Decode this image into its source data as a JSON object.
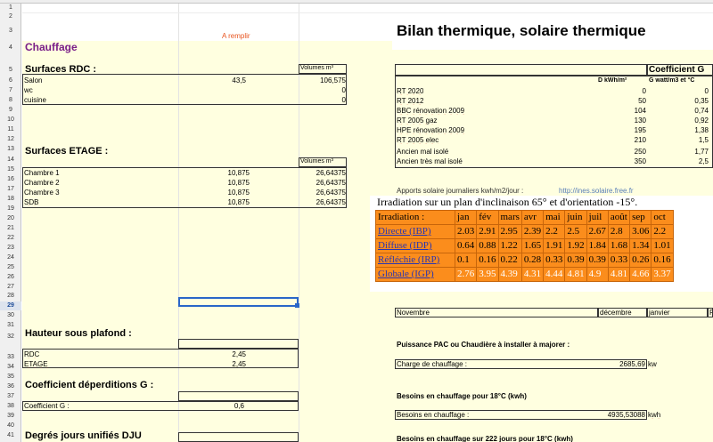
{
  "row_numbers": [
    "1",
    "2",
    "3",
    "4",
    "5",
    "6",
    "7",
    "8",
    "9",
    "10",
    "11",
    "12",
    "13",
    "14",
    "15",
    "16",
    "17",
    "18",
    "19",
    "20",
    "21",
    "22",
    "23",
    "24",
    "25",
    "26",
    "27",
    "28",
    "29",
    "30",
    "31",
    "32",
    "33",
    "34",
    "35",
    "36",
    "37",
    "38",
    "39",
    "40",
    "41"
  ],
  "active_row": "29",
  "left": {
    "a_remplir": "A remplir",
    "chauffage": "Chauffage",
    "rdc": {
      "title": "Surfaces RDC :",
      "vol_header": "Volumes m³",
      "rows": [
        {
          "name": "Salon",
          "surface": "43,5",
          "volume": "106,575"
        },
        {
          "name": "wc",
          "surface": "",
          "volume": "0"
        },
        {
          "name": "cuisine",
          "surface": "",
          "volume": "0"
        }
      ]
    },
    "etage": {
      "title": "Surfaces ETAGE :",
      "vol_header": "Volumes m³",
      "rows": [
        {
          "name": "Chambre 1",
          "surface": "10,875",
          "volume": "26,64375"
        },
        {
          "name": "Chambre 2",
          "surface": "10,875",
          "volume": "26,64375"
        },
        {
          "name": "Chambre 3",
          "surface": "10,875",
          "volume": "26,64375"
        },
        {
          "name": "SDB",
          "surface": "10,875",
          "volume": "26,64375"
        }
      ]
    },
    "hauteur": {
      "title": "Hauteur sous plafond :",
      "rows": [
        {
          "name": "RDC",
          "value": "2,45"
        },
        {
          "name": "ETAGE",
          "value": "2,45"
        }
      ]
    },
    "coef": {
      "title": "Coefficient déperditions G :",
      "label": "Coefficient G :",
      "value": "0,6"
    },
    "dju_title": "Degrés jours unifiés DJU"
  },
  "right": {
    "title": "Bilan thermique, solaire thermique",
    "coef_header": "Coefficient G",
    "col_kwh": "D kWh/m²",
    "col_watt": "G watt/m3 et °C",
    "rows": [
      {
        "name": "RT 2020",
        "kwh": "0",
        "g": "0"
      },
      {
        "name": "RT 2012",
        "kwh": "50",
        "g": "0,35"
      },
      {
        "name": "BBC rénovation 2009",
        "kwh": "104",
        "g": "0,74"
      },
      {
        "name": "RT 2005 gaz",
        "kwh": "130",
        "g": "0,92"
      },
      {
        "name": "HPE rénovation 2009",
        "kwh": "195",
        "g": "1,38"
      },
      {
        "name": "RT 2005 elec",
        "kwh": "210",
        "g": "1,5"
      },
      {
        "name": "Ancien mal isolé",
        "kwh": "250",
        "g": "1,77"
      },
      {
        "name": "Ancien très mal isolé",
        "kwh": "350",
        "g": "2,5"
      }
    ],
    "apports_text": "Apports solaire journaliers kwh/m2/jour :",
    "apports_link": "http://ines.solaire.free.fr",
    "irr_caption": "Irradiation sur un plan d'inclinaison 65° et d'orientation -15°.",
    "irr_header": [
      "Irradiation :",
      "jan",
      "fév",
      "mars",
      "avr",
      "mai",
      "juin",
      "juil",
      "août",
      "sep",
      "oct"
    ],
    "irr_rows": [
      {
        "label": "Directe (IBP)",
        "values": [
          "2.03",
          "2.91",
          "2.95",
          "2.39",
          "2.2",
          "2.5",
          "2.67",
          "2.8",
          "3.06",
          "2.2"
        ]
      },
      {
        "label": "Diffuse (IDP)",
        "values": [
          "0.64",
          "0.88",
          "1.22",
          "1.65",
          "1.91",
          "1.92",
          "1.84",
          "1.68",
          "1.34",
          "1.01"
        ]
      },
      {
        "label": "Réfléchie (IRP)",
        "values": [
          "0.1",
          "0.16",
          "0.22",
          "0.28",
          "0.33",
          "0.39",
          "0.39",
          "0.33",
          "0.26",
          "0.16"
        ]
      },
      {
        "label": "Globale (IGP)",
        "values": [
          "2.76",
          "3.95",
          "4.39",
          "4.31",
          "4.44",
          "4.81",
          "4.9",
          "4.81",
          "4.66",
          "3.37"
        ]
      }
    ],
    "months_row": {
      "novembre": "Novembre",
      "decembre": "décembre",
      "janvier": "janvier",
      "f": "F"
    },
    "pac_title": "Puissance PAC ou Chaudière à installer à majorer :",
    "charge_label": "Charge de chauffage :",
    "charge_value": "2685,69",
    "charge_unit": "kw",
    "besoins_title": "Besoins en chauffage pour 18°C (kwh)",
    "besoins_label": "Besoins en chauffage :",
    "besoins_value": "4935,53088",
    "besoins_unit": "kwh",
    "besoins222_title": "Besoins en chauffage sur 222 jours pour 18°C (kwh)"
  }
}
